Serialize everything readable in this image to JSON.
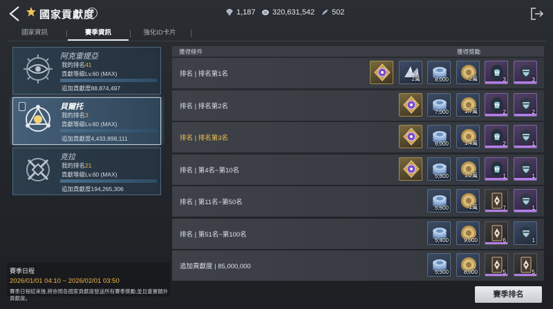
{
  "header": {
    "title": "國家貢獻度",
    "help": "?",
    "currencies": [
      {
        "icon": "crystal-icon",
        "value": "1,187"
      },
      {
        "icon": "silver-coin-icon",
        "value": "320,631,542"
      },
      {
        "icon": "feather-token-icon",
        "value": "502"
      }
    ]
  },
  "tabs": [
    "國家資訊",
    "賽季資訊",
    "強化ID卡片"
  ],
  "active_tab": 1,
  "nations": [
    {
      "name": "阿克雷提亞",
      "rank_label": "我的排名",
      "rank": "41",
      "level": "貢獻等級Lv.60 (MAX)",
      "contribution": "追加貢獻度88,874,497",
      "progress": 1.0,
      "selected": false
    },
    {
      "name": "貝爾托",
      "rank_label": "我的排名",
      "rank": "3",
      "level": "貢獻等級Lv.60 (MAX)",
      "contribution": "追加貢獻度4,433,898,111",
      "progress": 1.0,
      "selected": true
    },
    {
      "name": "克拉",
      "rank_label": "我的排名",
      "rank": "21",
      "level": "貢獻等級Lv.60 (MAX)",
      "contribution": "追加貢獻度194,265,306",
      "progress": 1.0,
      "selected": false
    }
  ],
  "season": {
    "heading": "賽季日程",
    "dates": "2026/01/01 04:10 ~ 2026/02/01 03:50",
    "note": "賽季日程結束後,將依照各國家貢獻度發送所有賽季獎勵,並且重置額外貢獻度。"
  },
  "table": {
    "col_condition": "獲得條件",
    "col_rewards": "獲得獎勵",
    "rows": [
      {
        "label": "排名 | 排名第1名",
        "highlight": false,
        "items": [
          {
            "kind": "gold",
            "icon": "medal-emblem-icon",
            "qty": ""
          },
          {
            "kind": "blue",
            "icon": "crystal-pile-icon",
            "qty": "2萬"
          },
          {
            "kind": "blue",
            "icon": "silver-coin-stack-icon",
            "qty": "8,000"
          },
          {
            "kind": "blue",
            "icon": "gold-coin-icon",
            "qty": "2萬"
          },
          {
            "kind": "purple",
            "icon": "hooded-figure-icon",
            "qty": "3"
          },
          {
            "kind": "purple",
            "icon": "armored-mask-icon",
            "qty": "3"
          }
        ]
      },
      {
        "label": "排名 | 排名第2名",
        "highlight": false,
        "items": [
          {
            "kind": "gold",
            "icon": "medal-emblem-icon",
            "qty": ""
          },
          {
            "kind": "blue",
            "icon": "silver-coin-stack-icon",
            "qty": "7,000"
          },
          {
            "kind": "blue",
            "icon": "gold-coin-icon",
            "qty": "1.7萬"
          },
          {
            "kind": "purple",
            "icon": "hooded-figure-icon",
            "qty": "2"
          },
          {
            "kind": "purple",
            "icon": "armored-mask-icon",
            "qty": "2"
          }
        ]
      },
      {
        "label": "排名 | 排名第3名",
        "highlight": true,
        "items": [
          {
            "kind": "gold",
            "icon": "medal-emblem-icon",
            "qty": ""
          },
          {
            "kind": "blue",
            "icon": "silver-coin-stack-icon",
            "qty": "6,000"
          },
          {
            "kind": "blue",
            "icon": "gold-coin-icon",
            "qty": "1.4萬"
          },
          {
            "kind": "purple",
            "icon": "hooded-figure-icon",
            "qty": "2"
          },
          {
            "kind": "purple",
            "icon": "armored-mask-icon",
            "qty": "1"
          }
        ]
      },
      {
        "label": "排名 | 第4名~第10名",
        "highlight": false,
        "items": [
          {
            "kind": "gold",
            "icon": "medal-emblem-icon",
            "qty": ""
          },
          {
            "kind": "blue",
            "icon": "silver-coin-stack-icon",
            "qty": "5,800"
          },
          {
            "kind": "blue",
            "icon": "gold-coin-icon",
            "qty": "1.2萬"
          },
          {
            "kind": "purple",
            "icon": "hooded-figure-icon",
            "qty": "1"
          },
          {
            "kind": "purple",
            "icon": "armored-mask-icon",
            "qty": "1"
          }
        ]
      },
      {
        "label": "排名 | 第11名~第50名",
        "highlight": false,
        "items": [
          {
            "kind": "blue",
            "icon": "silver-coin-stack-icon",
            "qty": "5,600"
          },
          {
            "kind": "blue",
            "icon": "gold-coin-icon",
            "qty": "1萬"
          },
          {
            "kind": "dark",
            "icon": "rune-card-icon",
            "qty": "7"
          },
          {
            "kind": "purple",
            "icon": "armored-mask-icon",
            "qty": "1"
          }
        ]
      },
      {
        "label": "排名 | 第51名~第100名",
        "highlight": false,
        "items": [
          {
            "kind": "blue",
            "icon": "silver-coin-stack-icon",
            "qty": "5,400"
          },
          {
            "kind": "blue",
            "icon": "gold-coin-icon",
            "qty": "9,000"
          },
          {
            "kind": "dark",
            "icon": "rune-card-icon",
            "qty": "6"
          },
          {
            "kind": "blue",
            "icon": "armored-mask-icon",
            "qty": "1"
          }
        ]
      },
      {
        "label": "追加貢獻度 | 85,000,000",
        "highlight": false,
        "items": [
          {
            "kind": "blue",
            "icon": "silver-coin-stack-icon",
            "qty": "5,300"
          },
          {
            "kind": "blue",
            "icon": "gold-coin-icon",
            "qty": "8,000"
          },
          {
            "kind": "dark",
            "icon": "rune-card-icon",
            "qty": "5"
          },
          {
            "kind": "dark",
            "icon": "rune-card-icon",
            "qty": "5"
          }
        ]
      }
    ]
  },
  "season_rank_button": "賽季排名",
  "colors": {
    "accent_gold": "#f2b646",
    "purple_rarity": "#b37fe6",
    "selected_border": "#b9d2e4"
  }
}
